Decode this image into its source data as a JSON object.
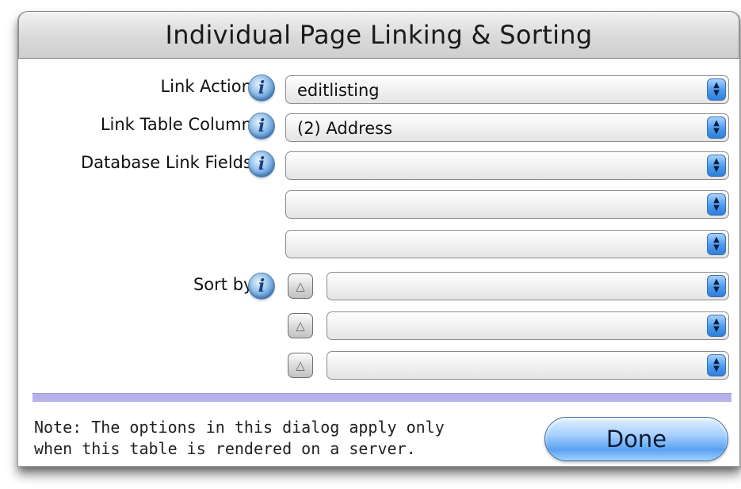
{
  "dialog": {
    "title": "Individual Page Linking & Sorting"
  },
  "fields": {
    "link_action_label": "Link Action:",
    "link_action_value": "editlisting",
    "link_table_column_label": "Link Table Column:",
    "link_table_column_value": "(2) Address",
    "database_link_fields_label": "Database Link Fields:",
    "database_link_fields_values": [
      "",
      "",
      ""
    ],
    "sort_by_label": "Sort by:",
    "sort_by_values": [
      "",
      "",
      ""
    ]
  },
  "icons": {
    "info": "info-icon",
    "sort_direction": "sort-ascending-icon",
    "popup_arrows": "up-down-arrows-icon"
  },
  "footer": {
    "note_line1": "Note: The options in this dialog apply only",
    "note_line2": "when this table is rendered on a server.",
    "done_label": "Done"
  },
  "colors": {
    "divider": "#b6b2ea",
    "accent_blue": "#4a9aef"
  }
}
